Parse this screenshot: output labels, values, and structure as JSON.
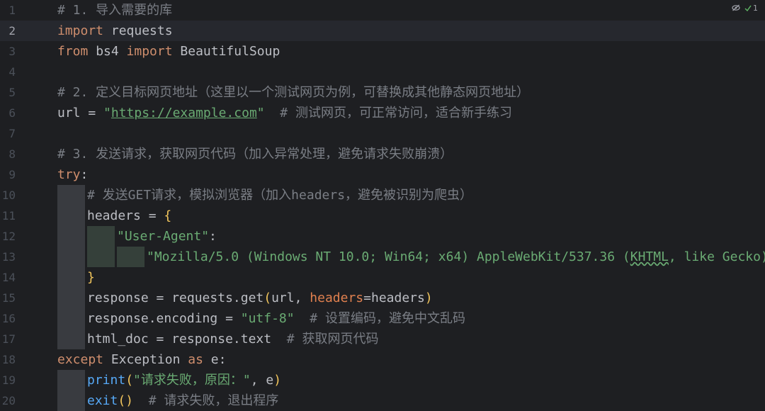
{
  "inspections": {
    "reader_mode_icon": "eye-slash-icon",
    "check_icon": "check-icon",
    "ok_count": "1"
  },
  "active_line": 2,
  "lines": [
    {
      "n": "1",
      "indent": 0,
      "t": [
        [
          "cm",
          "# 1. 导入需要的库"
        ]
      ]
    },
    {
      "n": "2",
      "indent": 0,
      "t": [
        [
          "kw",
          "import"
        ],
        [
          "",
          " requests"
        ]
      ]
    },
    {
      "n": "3",
      "indent": 0,
      "t": [
        [
          "kw",
          "from"
        ],
        [
          "",
          " bs4 "
        ],
        [
          "kw",
          "import"
        ],
        [
          "",
          " BeautifulSoup"
        ]
      ]
    },
    {
      "n": "4",
      "indent": 0,
      "t": []
    },
    {
      "n": "5",
      "indent": 0,
      "t": [
        [
          "cm",
          "# 2. 定义目标网页地址（这里以一个测试网页为例，可替换成其他静态网页地址）"
        ]
      ]
    },
    {
      "n": "6",
      "indent": 0,
      "t": [
        [
          "",
          "url = "
        ],
        [
          "str",
          "\""
        ],
        [
          "url",
          "https://example.com"
        ],
        [
          "str",
          "\""
        ],
        [
          "cm",
          "  # 测试网页，可正常访问，适合新手练习"
        ]
      ]
    },
    {
      "n": "7",
      "indent": 0,
      "t": []
    },
    {
      "n": "8",
      "indent": 0,
      "t": [
        [
          "cm",
          "# 3. 发送请求，获取网页代码（加入异常处理，避免请求失败崩溃）"
        ]
      ]
    },
    {
      "n": "9",
      "indent": 0,
      "t": [
        [
          "kw",
          "try"
        ],
        [
          "",
          ":"
        ]
      ]
    },
    {
      "n": "10",
      "indent": 1,
      "t": [
        [
          "cm",
          "# 发送GET请求，模拟浏览器（加入headers，避免被识别为爬虫）"
        ]
      ]
    },
    {
      "n": "11",
      "indent": 1,
      "t": [
        [
          "",
          "headers = "
        ],
        [
          "br",
          "{"
        ]
      ]
    },
    {
      "n": "12",
      "indent": 2,
      "t": [
        [
          "str",
          "\"User-Agent\""
        ],
        [
          "",
          ":"
        ]
      ]
    },
    {
      "n": "13",
      "indent": 3,
      "t": [
        [
          "str",
          "\"Mozilla/5.0 (Windows NT 10.0; Win64; x64) AppleWebKit/537.36 ("
        ],
        [
          "typo",
          "KHTML"
        ],
        [
          "str",
          ", like Gecko)"
        ]
      ]
    },
    {
      "n": "14",
      "indent": 1,
      "t": [
        [
          "br",
          "}"
        ]
      ]
    },
    {
      "n": "15",
      "indent": 1,
      "t": [
        [
          "",
          "response = requests.get"
        ],
        [
          "br",
          "("
        ],
        [
          "",
          "url, "
        ],
        [
          "kwarg",
          "headers"
        ],
        [
          "",
          "=headers"
        ],
        [
          "br",
          ")"
        ]
      ]
    },
    {
      "n": "16",
      "indent": 1,
      "t": [
        [
          "",
          "response.encoding = "
        ],
        [
          "str",
          "\"utf-8\""
        ],
        [
          "cm",
          "  # 设置编码，避免中文乱码"
        ]
      ]
    },
    {
      "n": "17",
      "indent": 1,
      "t": [
        [
          "",
          "html_doc = response.text"
        ],
        [
          "cm",
          "  # 获取网页代码"
        ]
      ]
    },
    {
      "n": "18",
      "indent": 0,
      "t": [
        [
          "kw",
          "except"
        ],
        [
          "cls",
          " Exception "
        ],
        [
          "kw",
          "as"
        ],
        [
          "",
          " e:"
        ]
      ]
    },
    {
      "n": "19",
      "indent": 1,
      "t": [
        [
          "fn",
          "print"
        ],
        [
          "br",
          "("
        ],
        [
          "str",
          "\"请求失败，原因：\""
        ],
        [
          "",
          ", e"
        ],
        [
          "br",
          ")"
        ]
      ]
    },
    {
      "n": "20",
      "indent": 1,
      "t": [
        [
          "fn",
          "exit"
        ],
        [
          "br",
          "()"
        ],
        [
          "cm",
          "  # 请求失败，退出程序"
        ]
      ]
    }
  ],
  "colors": {
    "background": "#1e1f22",
    "keyword": "#cf8e6d",
    "string": "#6aab73",
    "comment": "#7a7e85",
    "function": "#56a8f5",
    "bracket": "#f2c55c",
    "kwarg": "#e0804f",
    "text": "#bcbec4"
  }
}
